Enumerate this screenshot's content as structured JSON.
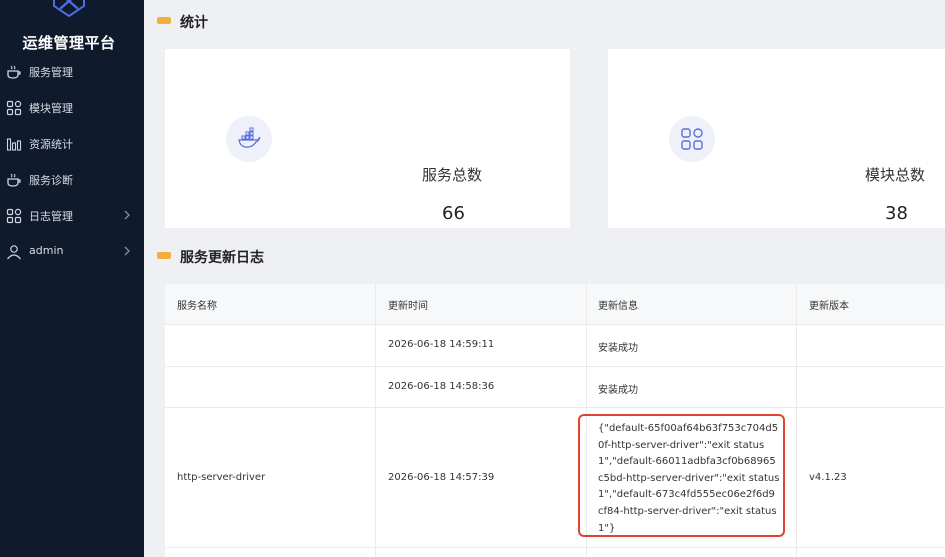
{
  "app": {
    "title": "运维管理平台",
    "logo_icon": "tools-icon"
  },
  "sidebar": {
    "items": [
      {
        "label": "服务管理",
        "icon": "service-icon"
      },
      {
        "label": "模块管理",
        "icon": "grid-icon"
      },
      {
        "label": "资源统计",
        "icon": "bar-chart-icon"
      },
      {
        "label": "服务诊断",
        "icon": "service-icon"
      },
      {
        "label": "日志管理",
        "icon": "grid-icon",
        "has_submenu": true
      },
      {
        "label": "admin",
        "icon": "user-icon",
        "has_submenu": true
      }
    ]
  },
  "stats": {
    "title": "统计",
    "cards": [
      {
        "label": "服务总数",
        "value": "66",
        "icon": "docker-icon"
      },
      {
        "label": "模块总数",
        "value": "38",
        "icon": "grid-icon"
      }
    ]
  },
  "log": {
    "title": "服务更新日志",
    "columns": [
      "服务名称",
      "更新时间",
      "更新信息",
      "更新版本"
    ],
    "rows": [
      {
        "name": "",
        "time": "2026-06-18 14:59:11",
        "message": "安装成功",
        "version": ""
      },
      {
        "name": "",
        "time": "2026-06-18 14:58:36",
        "message": "安装成功",
        "version": ""
      },
      {
        "name": "http-server-driver",
        "time": "2026-06-18 14:57:39",
        "message": "{\"default-65f00af64b63f753c704d50f-http-server-driver\":\"exit status 1\",\"default-66011adbfa3cf0b68965c5bd-http-server-driver\":\"exit status 1\",\"default-673c4fd555ec06e2f6d9cf84-http-server-driver\":\"exit status 1\"}",
        "version": "v4.1.23"
      }
    ]
  },
  "colors": {
    "sidebar_bg": "#0f1a2c",
    "accent": "#f0b03a",
    "highlight": "#e0442e",
    "icon_tint": "#5a6fd8"
  }
}
